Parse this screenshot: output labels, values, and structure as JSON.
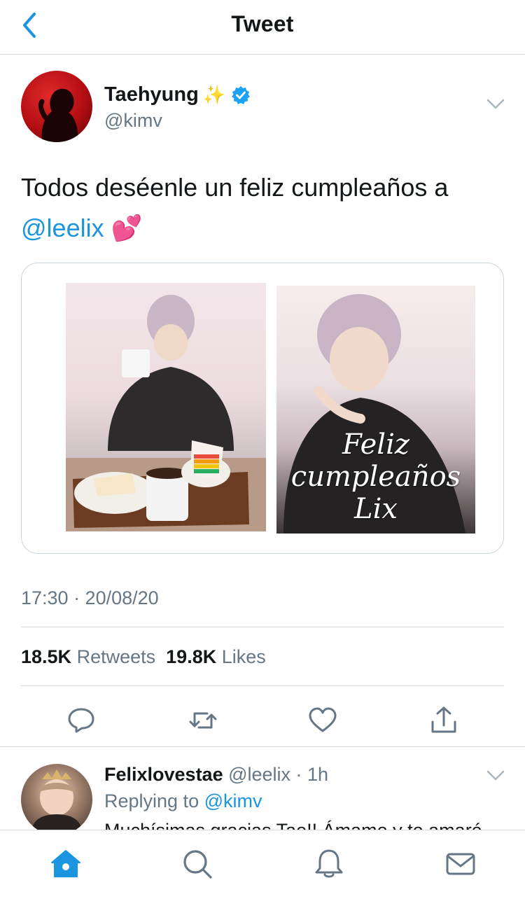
{
  "header": {
    "title": "Tweet",
    "back_icon": "chevron-left-icon"
  },
  "tweet": {
    "author_name": "Taehyung",
    "author_sparkle": "✨",
    "author_handle": "@kimv",
    "text_before": "Todos deséenle un feliz cumpleaños a ",
    "text_mention": "@leelix",
    "text_emoji": "💕",
    "photo_caption": "Feliz cumpleaños Lix",
    "timestamp": "17:30 · 20/08/20",
    "retweets_count": "18.5K",
    "retweets_label": "Retweets",
    "likes_count": "19.8K",
    "likes_label": "Likes"
  },
  "reply": {
    "name": "Felixlovestae",
    "meta": "@leelix · 1h",
    "replying_label": "Replying to",
    "replying_handle": "@kimv",
    "text": "Muchísimas gracias Tae!! Ámame y te amaré"
  },
  "tabs": [
    "home-icon",
    "search-icon",
    "notifications-icon",
    "messages-icon"
  ],
  "colors": {
    "link": "#1b95e0",
    "secondary": "#657786",
    "divider": "#d3d8dc"
  }
}
